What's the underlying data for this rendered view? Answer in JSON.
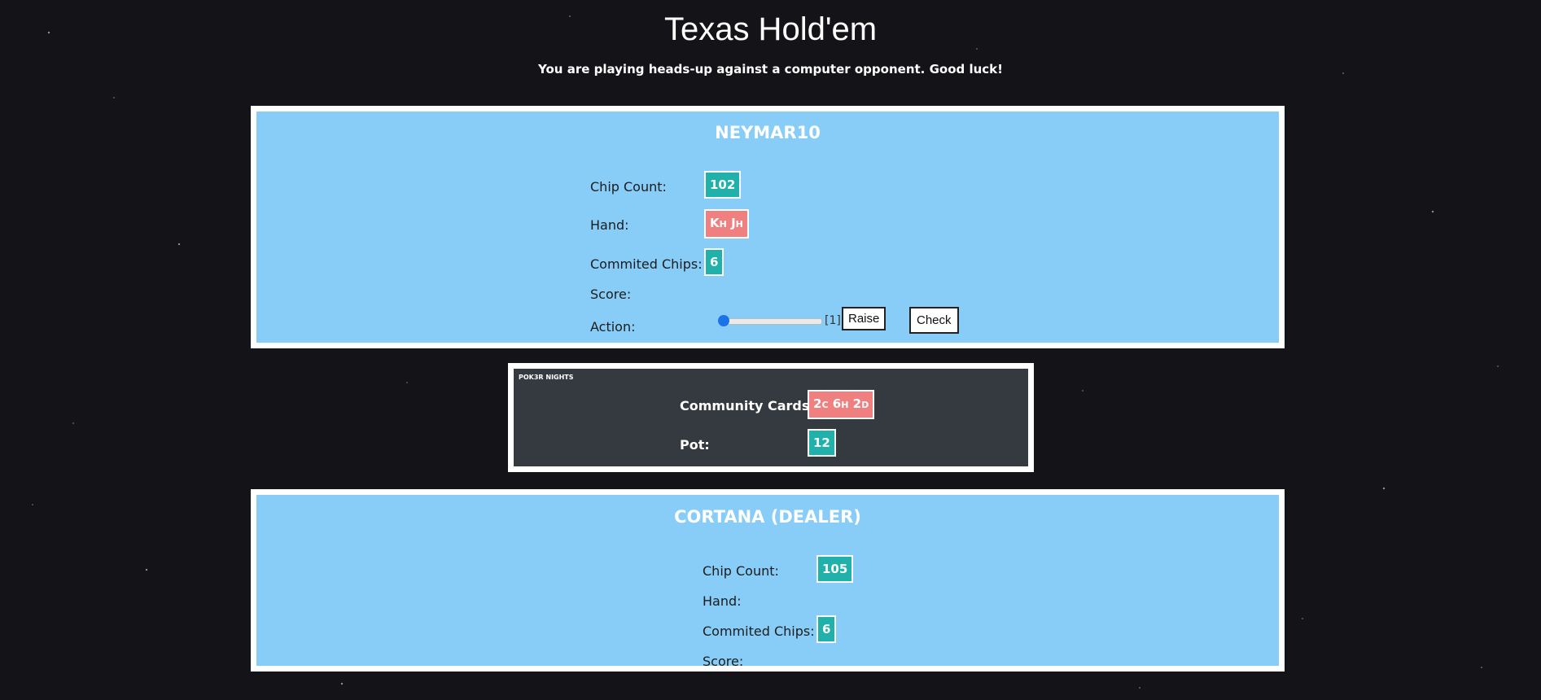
{
  "header": {
    "title": "Texas Hold'em",
    "subtitle": "You are playing heads-up against a computer opponent. Good luck!"
  },
  "player": {
    "name": "NEYMAR10",
    "chip_count_label": "Chip Count:",
    "chip_count": "102",
    "hand_label": "Hand:",
    "hand": [
      {
        "rank": "K",
        "suit": "H"
      },
      {
        "rank": "J",
        "suit": "H"
      }
    ],
    "committed_label": "Commited Chips:",
    "committed": "6",
    "score_label": "Score:",
    "action_label": "Action:",
    "raise_value_display": "[1]",
    "raise_fraction": 0.0,
    "raise_button": "Raise",
    "check_button": "Check"
  },
  "board": {
    "tag": "POK3R NIGHTS",
    "community_label": "Community Cards:",
    "community": [
      {
        "rank": "2",
        "suit": "C"
      },
      {
        "rank": "6",
        "suit": "H"
      },
      {
        "rank": "2",
        "suit": "D"
      }
    ],
    "pot_label": "Pot:",
    "pot": "12"
  },
  "opponent": {
    "name": "CORTANA (DEALER)",
    "chip_count_label": "Chip Count:",
    "chip_count": "105",
    "hand_label": "Hand:",
    "committed_label": "Commited Chips:",
    "committed": "6",
    "score_label": "Score:"
  },
  "colors": {
    "panel": "#87cdf7",
    "board": "#343a40",
    "chip_badge": "#20b2aa",
    "card_badge": "#f08080"
  }
}
